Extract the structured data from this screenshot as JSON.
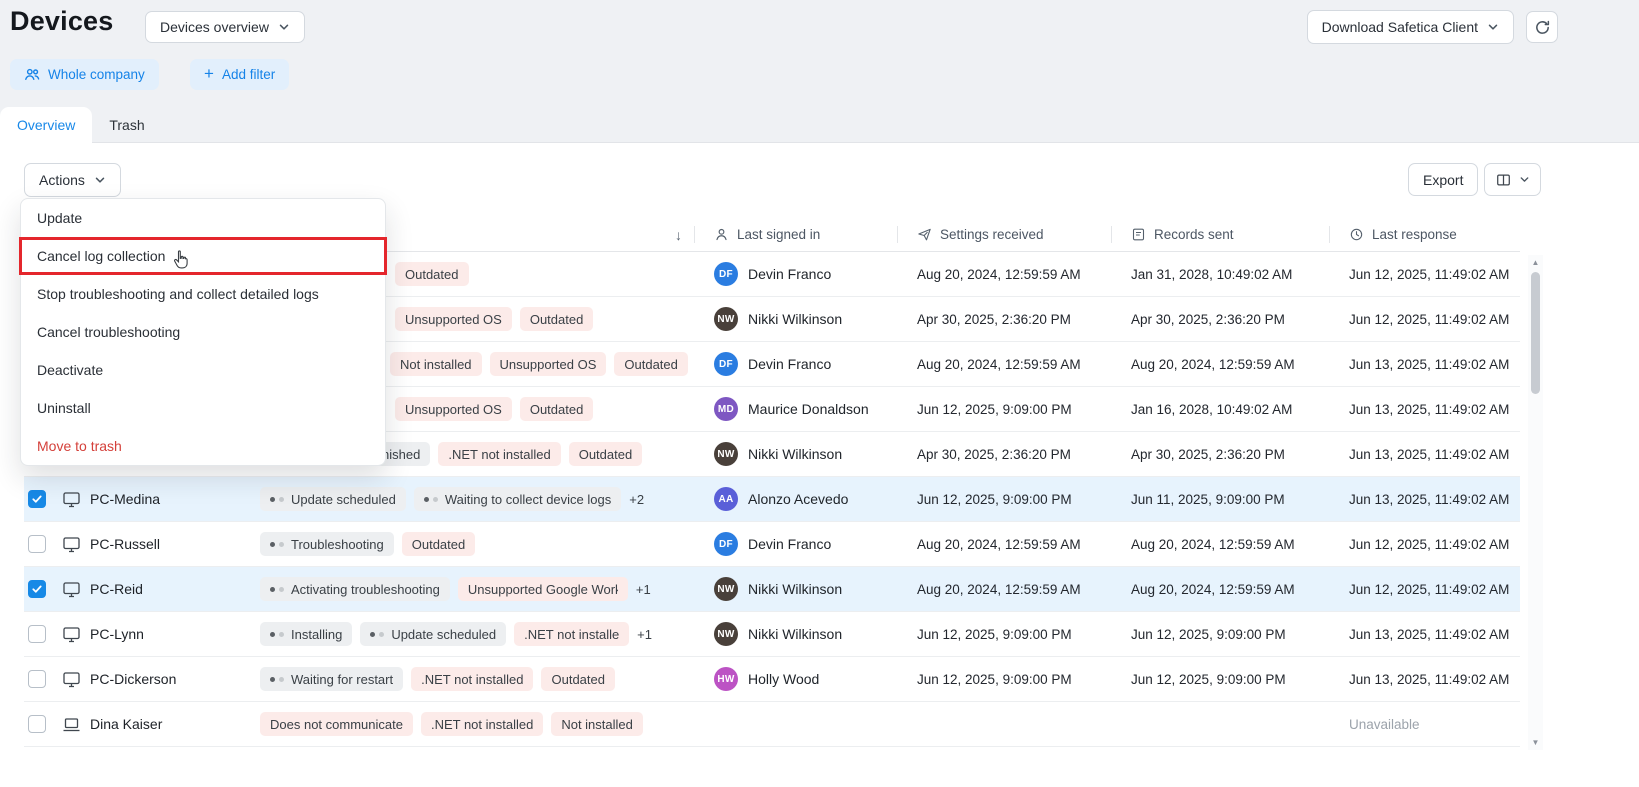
{
  "colors": {
    "accent": "#1789e6",
    "selection_bg": "#e7f3fd",
    "alert_badge_bg": "#fcebe9",
    "progress_badge_bg": "#edeff1",
    "danger_text": "#d4403a",
    "highlight_border": "#e4262c"
  },
  "icons": {
    "refresh": "refresh-icon",
    "scope": "people-icon",
    "add_filter": "plus-icon",
    "dropdowns": "chevron-down-icon",
    "columns": "columns-icon",
    "sort": "arrow-down-icon",
    "last_signed_in": "user-icon",
    "settings_received": "send-icon",
    "records_sent": "document-icon",
    "last_response": "clock-icon",
    "device_pc": "desktop-icon",
    "device_laptop": "laptop-icon",
    "pointer": "hand-cursor-icon"
  },
  "header": {
    "title": "Devices",
    "view_selector": "Devices overview",
    "download_button": "Download Safetica Client"
  },
  "filter_bar": {
    "scope_chip": "Whole company",
    "add_filter": "Add filter"
  },
  "tabs": {
    "overview": "Overview",
    "trash": "Trash"
  },
  "toolbar": {
    "actions": "Actions",
    "export": "Export"
  },
  "actions_menu": {
    "items": [
      {
        "label": "Update"
      },
      {
        "label": "Cancel log collection",
        "highlighted": true
      },
      {
        "label": "Stop troubleshooting and collect detailed logs"
      },
      {
        "label": "Cancel troubleshooting"
      },
      {
        "label": "Deactivate"
      },
      {
        "label": "Uninstall"
      },
      {
        "label": "Move to trash",
        "danger": true
      }
    ]
  },
  "table": {
    "sort_indicator": "↓",
    "columns": {
      "last_signed_in": "Last signed in",
      "settings_received": "Settings received",
      "records_sent": "Records sent",
      "last_response": "Last response"
    },
    "rows": [
      {
        "name": "",
        "device": null,
        "checked": false,
        "selected": false,
        "indent": 135,
        "badges": [
          {
            "text": "Outdated",
            "type": "alert"
          }
        ],
        "user": {
          "initials": "DF",
          "name": "Devin Franco",
          "color": "#2b7de1"
        },
        "settings_received": "Aug 20, 2024, 12:59:59 AM",
        "records_sent": "Jan 31, 2028, 10:49:02 AM",
        "last_response": "Jun 12, 2025, 11:49:02 AM"
      },
      {
        "name": "",
        "device": null,
        "checked": false,
        "selected": false,
        "indent": 135,
        "badges": [
          {
            "text": "Unsupported OS",
            "type": "alert"
          },
          {
            "text": "Outdated",
            "type": "alert"
          }
        ],
        "user": {
          "initials": "NW",
          "name": "Nikki Wilkinson",
          "color": "#49403a"
        },
        "settings_received": "Apr 30, 2025, 2:36:20 PM",
        "records_sent": "Apr 30, 2025, 2:36:20 PM",
        "last_response": "Jun 12, 2025, 11:49:02 AM"
      },
      {
        "name": "",
        "device": null,
        "checked": false,
        "selected": false,
        "indent": 130,
        "badges": [
          {
            "text": "Not installed",
            "type": "alert"
          },
          {
            "text": "Unsupported OS",
            "type": "alert"
          },
          {
            "text": "Outdated",
            "type": "alert"
          }
        ],
        "user": {
          "initials": "DF",
          "name": "Devin Franco",
          "color": "#2b7de1"
        },
        "settings_received": "Aug 20, 2024, 12:59:59 AM",
        "records_sent": "Aug 20, 2024, 12:59:59 AM",
        "last_response": "Jun 13, 2025, 11:49:02 AM"
      },
      {
        "name": "",
        "device": null,
        "checked": false,
        "selected": false,
        "indent": 135,
        "badges": [
          {
            "text": "Unsupported OS",
            "type": "alert"
          },
          {
            "text": "Outdated",
            "type": "alert"
          }
        ],
        "user": {
          "initials": "MD",
          "name": "Maurice Donaldson",
          "color": "#7e57c2"
        },
        "settings_received": "Jun 12, 2025, 9:09:00 PM",
        "records_sent": "Jan 16, 2028, 10:49:02 AM",
        "last_response": "Jun 13, 2025, 11:49:02 AM"
      },
      {
        "name": "",
        "device": null,
        "checked": false,
        "selected": false,
        "indent": 60,
        "badges": [
          {
            "text": "Update finished",
            "type": "neutral"
          },
          {
            "text": ".NET not installed",
            "type": "alert"
          },
          {
            "text": "Outdated",
            "type": "alert"
          }
        ],
        "user": {
          "initials": "NW",
          "name": "Nikki Wilkinson",
          "color": "#49403a"
        },
        "settings_received": "Apr 30, 2025, 2:36:20 PM",
        "records_sent": "Apr 30, 2025, 2:36:20 PM",
        "last_response": "Jun 13, 2025, 11:49:02 AM"
      },
      {
        "name": "PC-Medina",
        "device": "desktop",
        "checked": true,
        "selected": true,
        "badges": [
          {
            "text": "Update scheduled",
            "type": "progress"
          },
          {
            "text": "Waiting to collect device logs",
            "type": "progress",
            "clip": 200
          }
        ],
        "more": "+2",
        "user": {
          "initials": "AA",
          "name": "Alonzo Acevedo",
          "color": "#5a5fd8"
        },
        "settings_received": "Jun 12, 2025, 9:09:00 PM",
        "records_sent": "Jun 11, 2025, 9:09:00 PM",
        "last_response": "Jun 13, 2025, 11:49:02 AM"
      },
      {
        "name": "PC-Russell",
        "device": "desktop",
        "checked": false,
        "selected": false,
        "badges": [
          {
            "text": "Troubleshooting",
            "type": "progress"
          },
          {
            "text": "Outdated",
            "type": "alert"
          }
        ],
        "user": {
          "initials": "DF",
          "name": "Devin Franco",
          "color": "#2b7de1"
        },
        "settings_received": "Aug 20, 2024, 12:59:59 AM",
        "records_sent": "Aug 20, 2024, 12:59:59 AM",
        "last_response": "Jun 12, 2025, 11:49:02 AM"
      },
      {
        "name": "PC-Reid",
        "device": "desktop",
        "checked": true,
        "selected": true,
        "badges": [
          {
            "text": "Activating troubleshooting",
            "type": "progress"
          },
          {
            "text": "Unsupported Google Work",
            "type": "alert",
            "clip": 150
          }
        ],
        "more": "+1",
        "user": {
          "initials": "NW",
          "name": "Nikki Wilkinson",
          "color": "#49403a"
        },
        "settings_received": "Aug 20, 2024, 12:59:59 AM",
        "records_sent": "Aug 20, 2024, 12:59:59 AM",
        "last_response": "Jun 12, 2025, 11:49:02 AM"
      },
      {
        "name": "PC-Lynn",
        "device": "desktop",
        "checked": false,
        "selected": false,
        "badges": [
          {
            "text": "Installing",
            "type": "progress"
          },
          {
            "text": "Update scheduled",
            "type": "progress"
          },
          {
            "text": ".NET not installed",
            "type": "alert",
            "clip": 95
          }
        ],
        "more": "+1",
        "user": {
          "initials": "NW",
          "name": "Nikki Wilkinson",
          "color": "#49403a"
        },
        "settings_received": "Jun 12, 2025, 9:09:00 PM",
        "records_sent": "Jun 12, 2025, 9:09:00 PM",
        "last_response": "Jun 13, 2025, 11:49:02 AM"
      },
      {
        "name": "PC-Dickerson",
        "device": "desktop",
        "checked": false,
        "selected": false,
        "badges": [
          {
            "text": "Waiting for restart",
            "type": "progress"
          },
          {
            "text": ".NET not installed",
            "type": "alert"
          },
          {
            "text": "Outdated",
            "type": "alert"
          }
        ],
        "user": {
          "initials": "HW",
          "name": "Holly Wood",
          "color": "#bc53c4"
        },
        "settings_received": "Jun 12, 2025, 9:09:00 PM",
        "records_sent": "Jun 12, 2025, 9:09:00 PM",
        "last_response": "Jun 13, 2025, 11:49:02 AM"
      },
      {
        "name": "Dina Kaiser",
        "device": "laptop",
        "checked": false,
        "selected": false,
        "badges": [
          {
            "text": "Does not communicate",
            "type": "alert"
          },
          {
            "text": ".NET not installed",
            "type": "alert"
          },
          {
            "text": "Not installed",
            "type": "alert"
          }
        ],
        "user": null,
        "settings_received": "",
        "records_sent": "",
        "last_response": "Unavailable",
        "response_muted": true
      }
    ]
  }
}
